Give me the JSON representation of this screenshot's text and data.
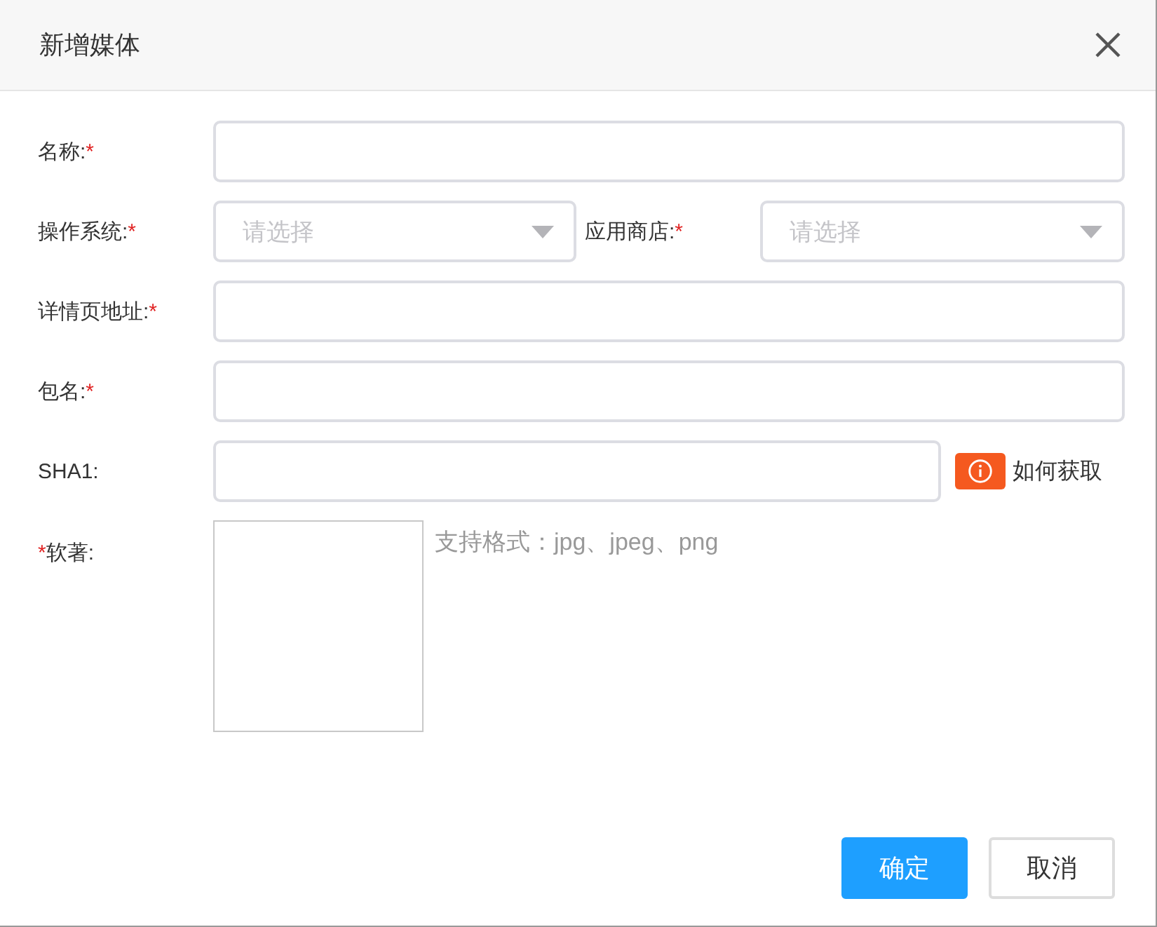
{
  "dialog": {
    "title": "新增媒体"
  },
  "rows": [
    {
      "kind": "text",
      "label": "名称:",
      "star": "*",
      "star_first": false
    },
    {
      "kind": "select_pair",
      "fields": [
        {
          "label": "操作系统:",
          "star": "*",
          "star_first": false,
          "placeholder": "请选择"
        },
        {
          "label": "应用商店:",
          "star": "*",
          "star_first": false,
          "placeholder": "请选择"
        }
      ]
    },
    {
      "kind": "text",
      "label": "详情页地址:",
      "star": "*",
      "star_first": false
    },
    {
      "kind": "text",
      "label": "包名:",
      "star": "*",
      "star_first": false
    },
    {
      "kind": "text_help",
      "label": "SHA1:",
      "help": "如何获取"
    },
    {
      "kind": "upload",
      "label": "软著:",
      "star": "*",
      "star_first": true,
      "hint": "支持格式：jpg、jpeg、png"
    }
  ],
  "buttons": [
    {
      "label": "确定",
      "kind": "primary"
    },
    {
      "label": "取消",
      "kind": "default"
    }
  ]
}
